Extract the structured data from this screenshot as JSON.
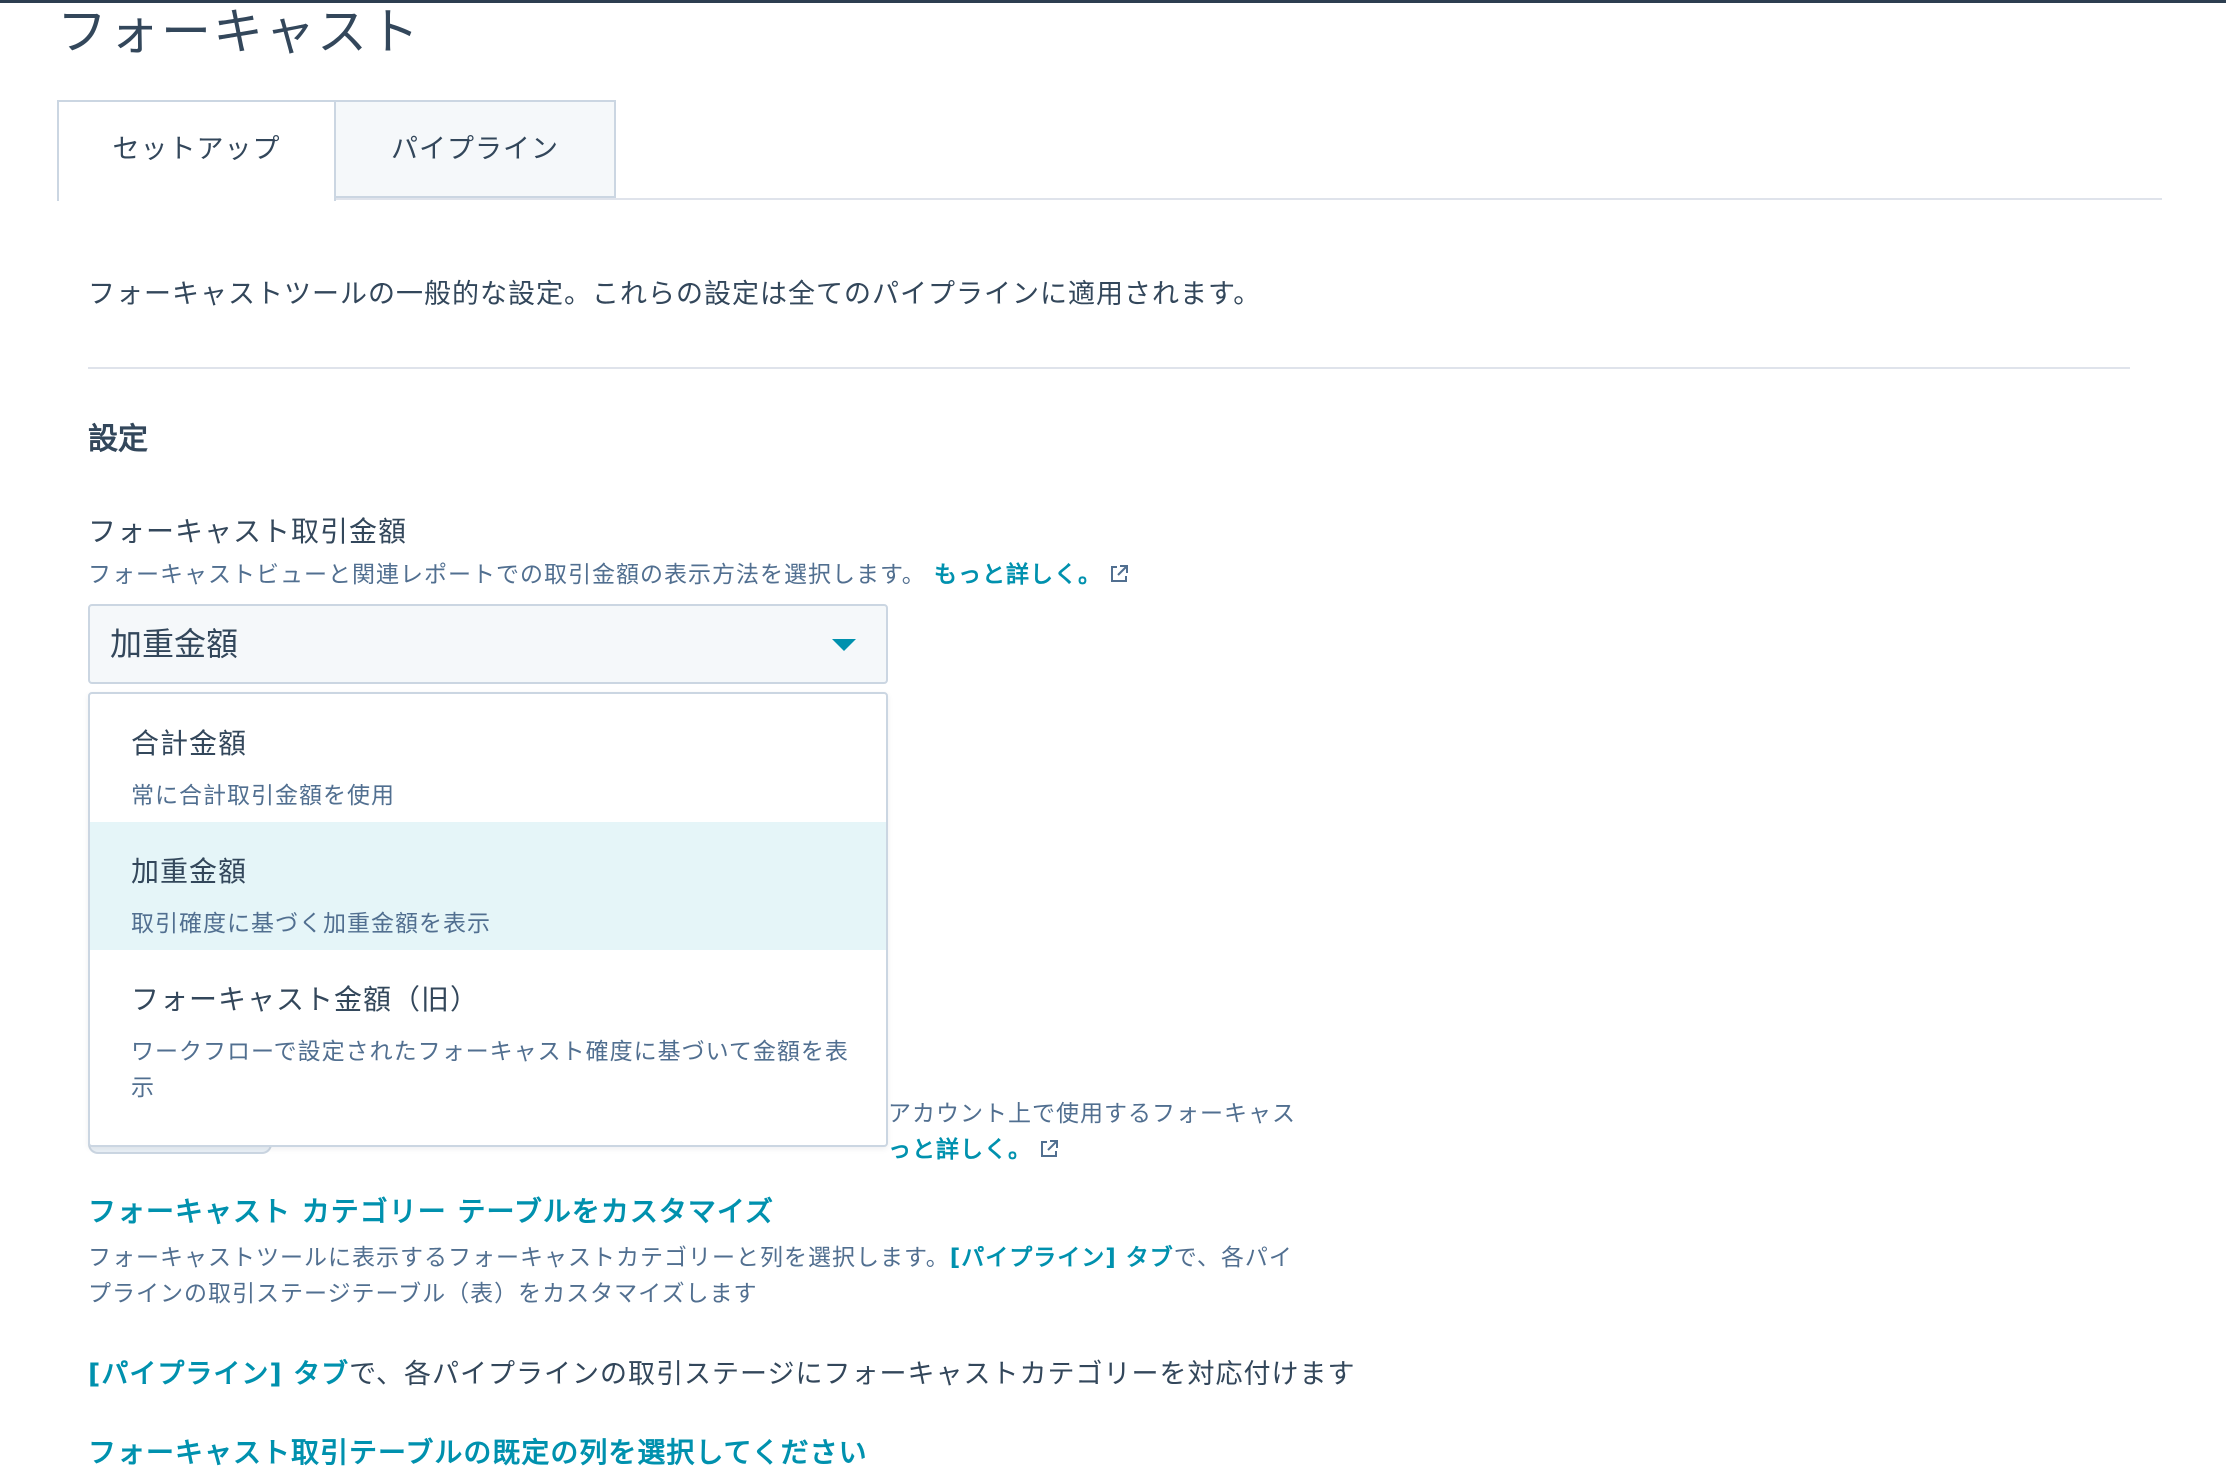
{
  "page": {
    "title": "フォーキャスト"
  },
  "tabs": [
    {
      "label": "セットアップ",
      "active": true
    },
    {
      "label": "パイプライン",
      "active": false
    }
  ],
  "intro_text": "フォーキャストツールの一般的な設定。これらの設定は全てのパイプラインに適用されます。",
  "settings": {
    "heading": "設定",
    "amount_field": {
      "label": "フォーキャスト取引金額",
      "help": "フォーキャストビューと関連レポートでの取引金額の表示方法を選択します。",
      "learn_more": "もっと詳しく。",
      "external_icon": "external-link-icon",
      "selected_value": "加重金額",
      "options": [
        {
          "title": "合計金額",
          "description": "常に合計取引金額を使用",
          "selected": false
        },
        {
          "title": "加重金額",
          "description": "取引確度に基づく加重金額を表示",
          "selected": true
        },
        {
          "title": "フォーキャスト金額（旧）",
          "description": "ワークフローで設定されたフォーキャスト確度に基づいて金額を表示",
          "selected": false
        }
      ]
    },
    "obscured": {
      "line1_tail": "アカウント上で使用するフォーキャス",
      "line2_tail": "っと詳しく。"
    },
    "category_table": {
      "link": "フォーキャスト カテゴリー テーブルをカスタマイズ",
      "desc_before": "フォーキャストツールに表示するフォーキャストカテゴリーと列を選択します。",
      "desc_link": "[パイプライン] タブ",
      "desc_after": "で、各パイプラインの取引ステージテーブル（表）をカスタマイズします"
    },
    "pipeline_mapping": {
      "link": "[パイプライン] タブ",
      "text": "で、各パイプラインの取引ステージにフォーキャストカテゴリーを対応付けます"
    },
    "default_columns_link": "フォーキャスト取引テーブルの既定の列を選択してください"
  },
  "colors": {
    "link": "#0091ae",
    "text": "#33475b",
    "muted": "#516f90",
    "selected_bg": "#e5f5f8",
    "border": "#cbd6e2"
  }
}
